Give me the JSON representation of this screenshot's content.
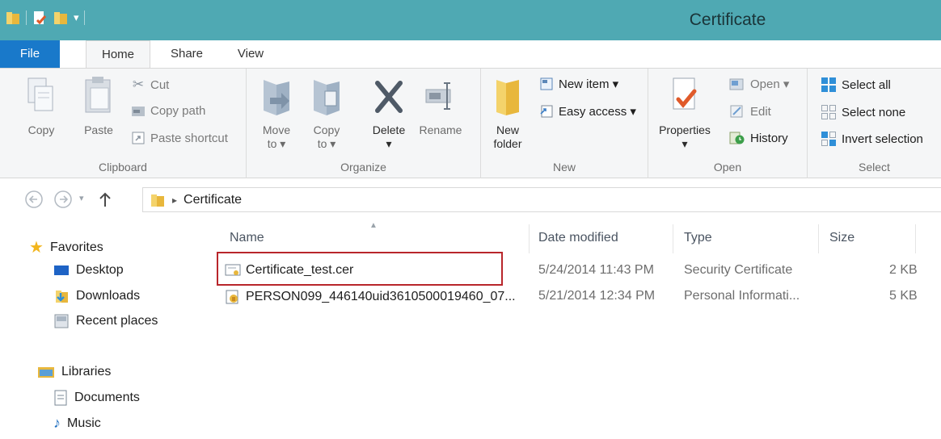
{
  "window": {
    "title": "Certificate"
  },
  "ribbon_tabs": {
    "file": "File",
    "home": "Home",
    "share": "Share",
    "view": "View"
  },
  "clipboard": {
    "copy": "Copy",
    "paste": "Paste",
    "cut": "Cut",
    "copy_path": "Copy path",
    "paste_shortcut": "Paste shortcut",
    "label": "Clipboard"
  },
  "organize": {
    "move_to": "Move",
    "move_to_2": "to ▾",
    "copy_to": "Copy",
    "copy_to_2": "to ▾",
    "delete": "Delete",
    "delete_arrow": "▾",
    "rename": "Rename",
    "label": "Organize"
  },
  "new": {
    "new_folder": "New",
    "new_folder_2": "folder",
    "new_item": "New item ▾",
    "easy_access": "Easy access ▾",
    "label": "New"
  },
  "open": {
    "properties": "Properties",
    "properties_arrow": "▾",
    "open": "Open ▾",
    "edit": "Edit",
    "history": "History",
    "label": "Open"
  },
  "select": {
    "select_all": "Select all",
    "select_none": "Select none",
    "invert_selection": "Invert selection",
    "label": "Select"
  },
  "address": {
    "crumb": "Certificate"
  },
  "navpane": {
    "favorites": "Favorites",
    "desktop": "Desktop",
    "downloads": "Downloads",
    "recent_places": "Recent places",
    "libraries": "Libraries",
    "documents": "Documents",
    "music": "Music"
  },
  "columns": {
    "name": "Name",
    "date_modified": "Date modified",
    "type": "Type",
    "size": "Size"
  },
  "files": [
    {
      "name": "Certificate_test.cer",
      "date": "5/24/2014 11:43 PM",
      "type": "Security Certificate",
      "size": "2 KB"
    },
    {
      "name": "PERSON099_446140uid3610500019460_07...",
      "date": "5/21/2014 12:34 PM",
      "type": "Personal Informati...",
      "size": "5 KB"
    }
  ],
  "colors": {
    "titlebar": "#4fa9b3",
    "file_tab": "#1979ca",
    "highlight": "#b8262b",
    "folder": "#e8b73c"
  }
}
